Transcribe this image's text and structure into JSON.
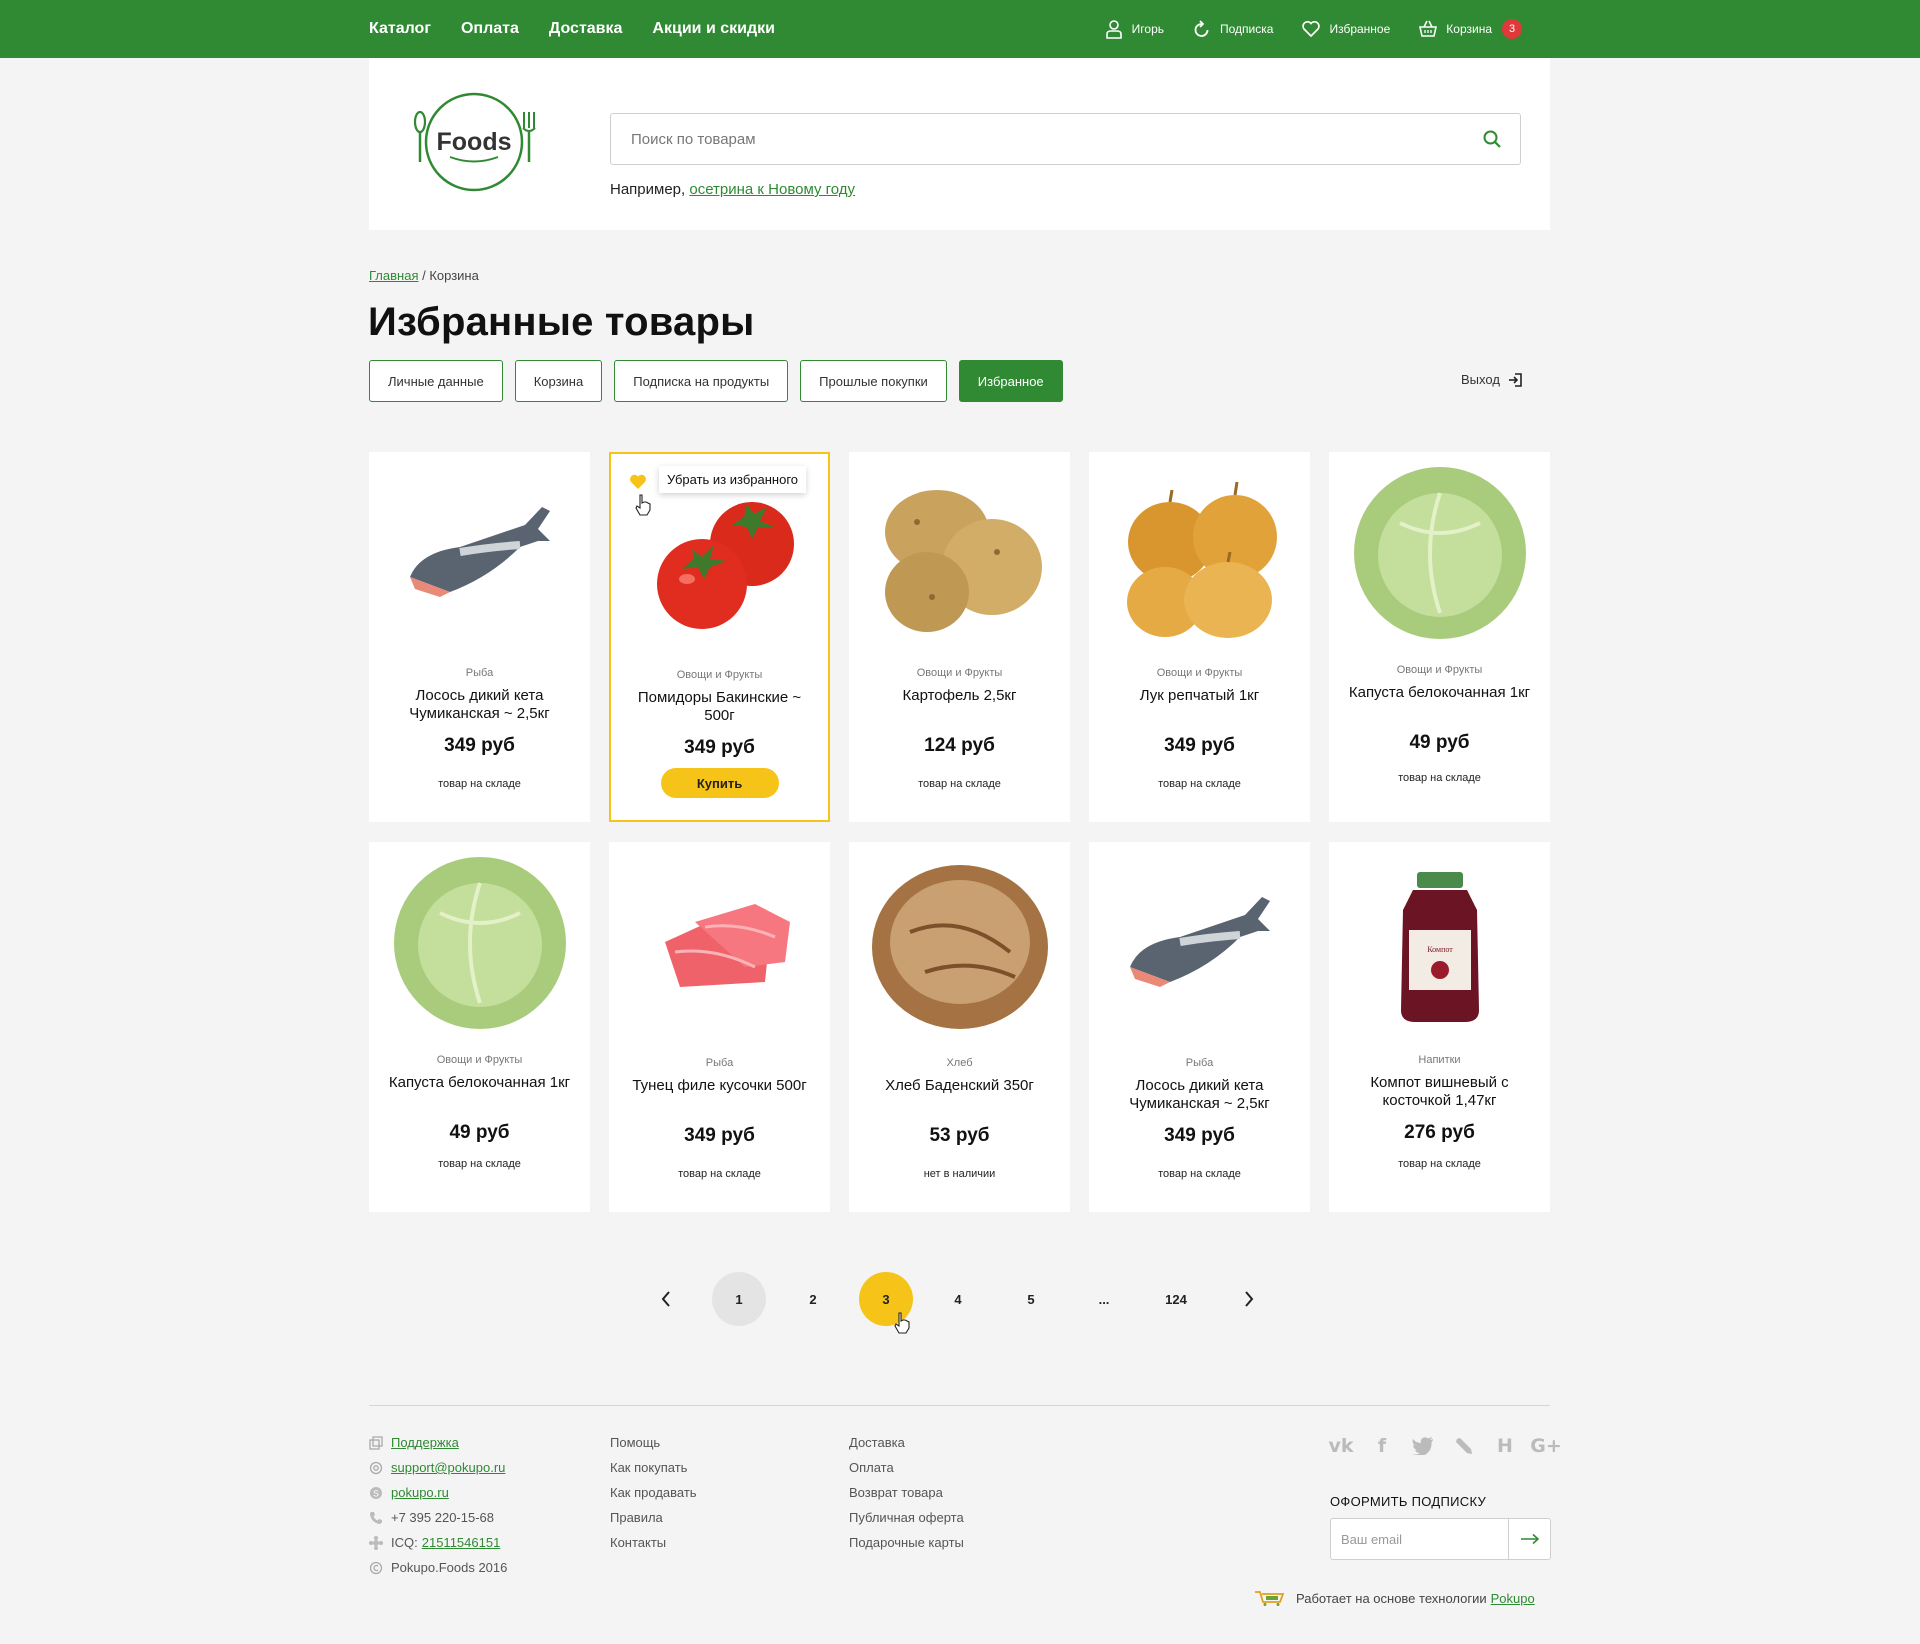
{
  "topnav": [
    "Каталог",
    "Оплата",
    "Доставка",
    "Акции и скидки"
  ],
  "topright": {
    "user": "Игорь",
    "subscription": "Подписка",
    "favorites": "Избранное",
    "cart": "Корзина",
    "cart_count": "3"
  },
  "logo_text": "Foods",
  "search": {
    "placeholder": "Поиск по товарам",
    "example_prefix": "Например,",
    "example_link": "осетрина к Новому году"
  },
  "breadcrumb": {
    "home": "Главная",
    "separator": " / ",
    "current": "Корзина"
  },
  "page_title": "Избранные товары",
  "tabs": [
    "Личные данные",
    "Корзина",
    "Подписка на продукты",
    "Прошлые покупки",
    "Избранное"
  ],
  "active_tab": "Избранное",
  "logout": "Выход",
  "products": [
    {
      "category": "Рыба",
      "name": "Лосось дикий кета Чумиканская ~ 2,5кг",
      "price": "349 руб",
      "stock": "товар на складе",
      "image": "salmon"
    },
    {
      "category": "Овощи и Фрукты",
      "name": "Помидоры Бакинские ~ 500г",
      "price": "349 руб",
      "stock": "",
      "image": "tomato",
      "buy_label": "Купить",
      "tooltip": "Убрать из избранного"
    },
    {
      "category": "Овощи и Фрукты",
      "name": "Картофель 2,5кг",
      "price": "124 руб",
      "stock": "товар на складе",
      "image": "potato"
    },
    {
      "category": "Овощи и Фрукты",
      "name": "Лук репчатый 1кг",
      "price": "349 руб",
      "stock": "товар на складе",
      "image": "onion"
    },
    {
      "category": "Овощи и Фрукты",
      "name": "Капуста белокочанная 1кг",
      "price": "49 руб",
      "stock": "товар на складе",
      "image": "cabbage"
    },
    {
      "category": "Овощи и Фрукты",
      "name": "Капуста белокочанная 1кг",
      "price": "49 руб",
      "stock": "товар на складе",
      "image": "cabbage"
    },
    {
      "category": "Рыба",
      "name": "Тунец филе кусочки 500г",
      "price": "349 руб",
      "stock": "товар на складе",
      "image": "tuna"
    },
    {
      "category": "Хлеб",
      "name": "Хлеб Баденский 350г",
      "price": "53 руб",
      "stock": "нет в наличии",
      "image": "bread"
    },
    {
      "category": "Рыба",
      "name": "Лосось дикий кета Чумиканская ~ 2,5кг",
      "price": "349 руб",
      "stock": "товар на складе",
      "image": "salmon"
    },
    {
      "category": "Напитки",
      "name": "Компот вишневый с косточкой 1,47кг",
      "price": "276 руб",
      "stock": "товар на складе",
      "image": "compote"
    }
  ],
  "pagination": [
    "1",
    "2",
    "3",
    "4",
    "5",
    "...",
    "124"
  ],
  "current_page": "3",
  "footer": {
    "col1": {
      "support": "Поддержка",
      "email": "support@pokupo.ru",
      "site": "pokupo.ru",
      "phone": "+7 395 220-15-68",
      "icq_label": "ICQ:",
      "icq": "21511546151",
      "copyright": "Pokupo.Foods 2016"
    },
    "col2": [
      "Помощь",
      "Как покупать",
      "Как продавать",
      "Правила",
      "Контакты"
    ],
    "col3": [
      "Доставка",
      "Оплата",
      "Возврат товара",
      "Публичная оферта",
      "Подарочные карты"
    ],
    "social": [
      "vk-icon",
      "facebook-icon",
      "twitter-icon",
      "livejournal-icon",
      "habr-icon",
      "googleplus-icon"
    ],
    "subscribe_title": "ОФОРМИТЬ ПОДПИСКУ",
    "email_placeholder": "Ваш email",
    "powered_text": "Работает на основе технологии",
    "powered_link": "Pokupo"
  },
  "colors": {
    "brand_green": "#2f8a33",
    "accent_yellow": "#f6c419",
    "badge_red": "#e0393b"
  }
}
